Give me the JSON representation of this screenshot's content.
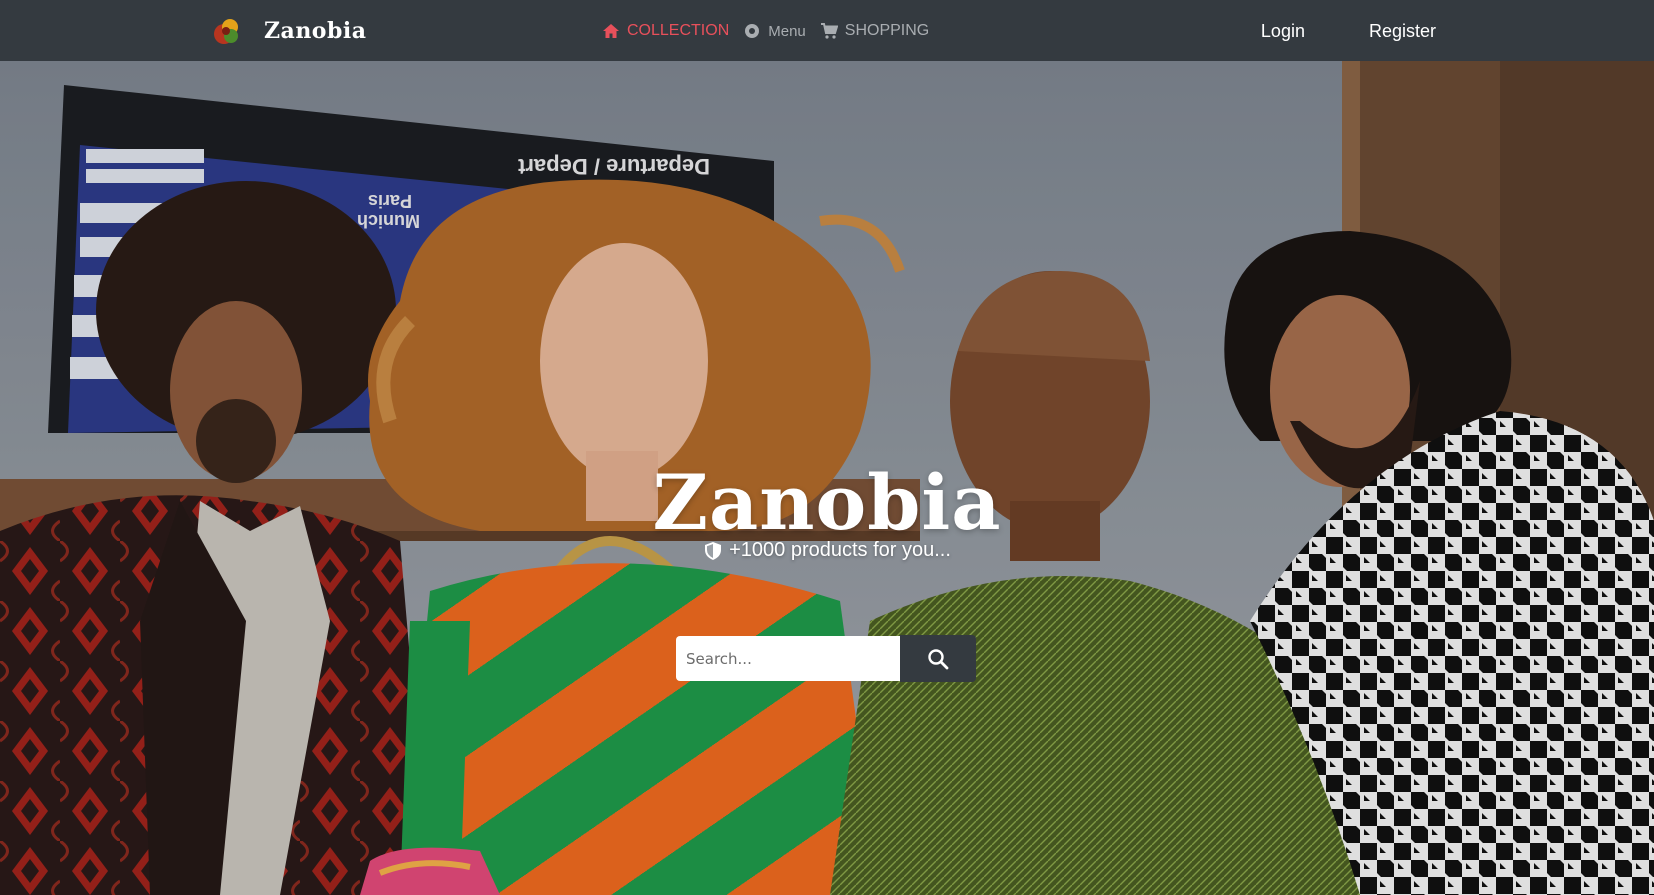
{
  "brand": {
    "name": "Zanobia",
    "logo_icon": "brand-logo-icon"
  },
  "nav": {
    "items": [
      {
        "label": "COLLECTION",
        "icon": "home-icon",
        "active": true
      },
      {
        "label": "Menu",
        "icon": "circle-dot-icon",
        "active": false
      },
      {
        "label": "SHOPPING",
        "icon": "cart-icon",
        "active": false
      }
    ],
    "login_label": "Login",
    "register_label": "Register"
  },
  "hero": {
    "title": "Zanobia",
    "tagline": "+1000 products for you...",
    "tagline_icon": "shield-icon",
    "image": "hero-photo-four-people-fashion"
  },
  "search": {
    "placeholder": "Search...",
    "value": "",
    "button_icon": "search-icon"
  },
  "colors": {
    "navbar_bg": "#343a40",
    "active_link": "#e8505b",
    "inactive_link": "#a9adb1",
    "text_light": "#ffffff"
  }
}
